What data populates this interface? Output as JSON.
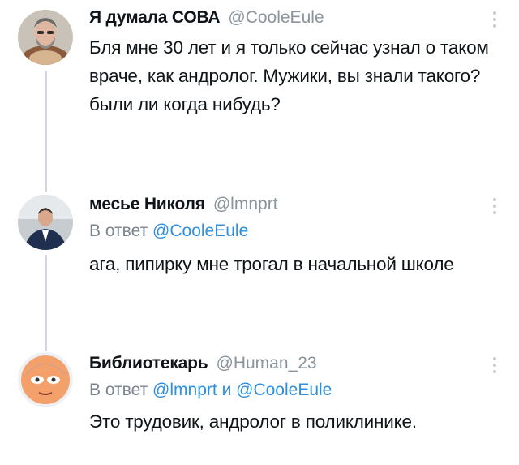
{
  "tweets": [
    {
      "name": "Я думала СОВА",
      "handle": "@CooleEule",
      "text": "Бля мне 30 лет и я только сейчас узнал о таком враче, как андролог. Мужики, вы знали такого? были ли когда нибудь?"
    },
    {
      "name": "месье Николя",
      "handle": "@lmnprt",
      "reply_prefix": "В ответ",
      "reply_to": "@CooleEule",
      "text": "ага, пипирку мне трогал в начальной школе"
    },
    {
      "name": "Библиотекарь",
      "handle": "@Human_23",
      "reply_prefix": "В ответ",
      "reply_to_1": "@lmnprt",
      "reply_joiner": "и",
      "reply_to_2": "@CooleEule",
      "text": "Это трудовик, андролог в поликлинике."
    }
  ],
  "icons": {
    "more": "more-vertical-icon"
  }
}
